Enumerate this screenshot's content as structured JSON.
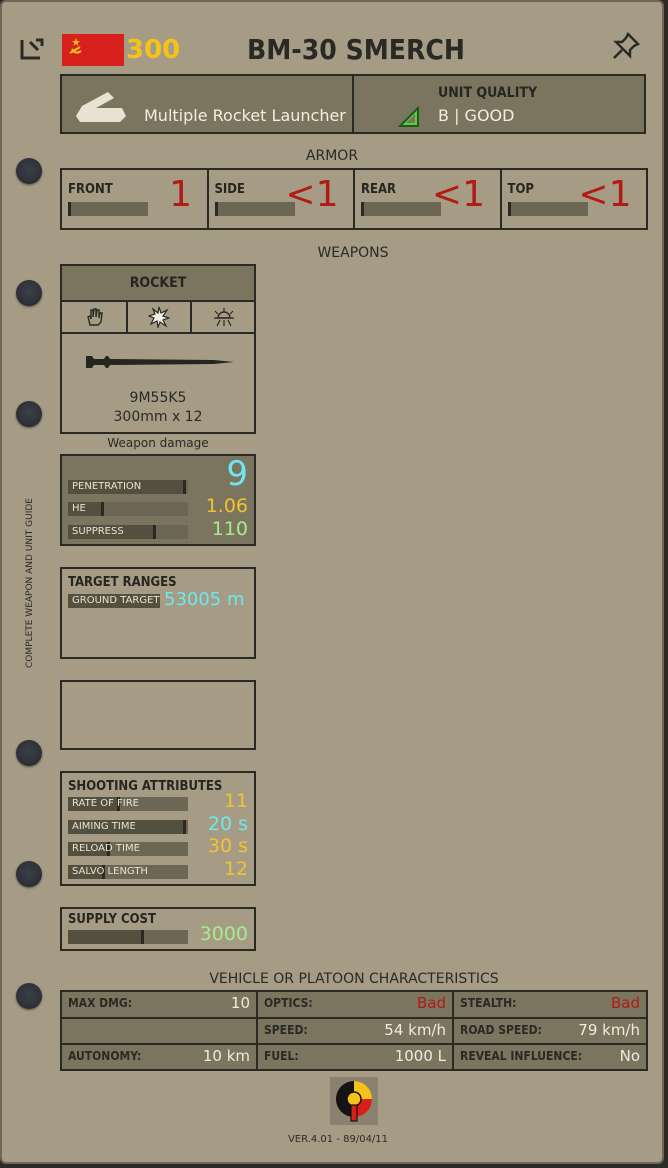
{
  "header": {
    "cost": "300",
    "title": "BM-30 SMERCH",
    "unit_type": "Multiple Rocket Launcher",
    "quality_label": "UNIT QUALITY",
    "quality_value": "B | GOOD"
  },
  "armor": {
    "section_title": "ARMOR",
    "items": [
      {
        "label": "FRONT",
        "value": "1",
        "fill": 0.02
      },
      {
        "label": "SIDE",
        "value": "<1",
        "fill": 0.01
      },
      {
        "label": "REAR",
        "value": "<1",
        "fill": 0.01
      },
      {
        "label": "TOP",
        "value": "<1",
        "fill": 0.01
      }
    ]
  },
  "weapons": {
    "section_title": "WEAPONS",
    "weapon_type": "ROCKET",
    "weapon_name": "9M55K5",
    "caliber": "300mm x 12",
    "damage_caption": "Weapon damage"
  },
  "damage": {
    "penetration_label": "PENETRATION",
    "penetration_value": "9",
    "penetration_fill": 0.98,
    "he_label": "HE",
    "he_value": "1.06",
    "he_fill": 0.3,
    "suppress_label": "SUPPRESS",
    "suppress_value": "110",
    "suppress_fill": 0.73
  },
  "ranges": {
    "title": "TARGET RANGES",
    "ground_label": "GROUND TARGET",
    "ground_value": "53005 m"
  },
  "shooting": {
    "title": "SHOOTING ATTRIBUTES",
    "rows": [
      {
        "label": "RATE OF FIRE",
        "value": "11",
        "fill": 0.43
      },
      {
        "label": "AIMING TIME",
        "value": "20 s",
        "fill": 0.98
      },
      {
        "label": "RELOAD TIME",
        "value": "30 s",
        "fill": 0.35
      },
      {
        "label": "SALVO LENGTH",
        "value": "12",
        "fill": 0.31
      }
    ]
  },
  "supply": {
    "title": "SUPPLY COST",
    "value": "3000",
    "fill": 0.63
  },
  "vehicle": {
    "section_title": "VEHICLE OR PLATOON CHARACTERISTICS",
    "max_dmg_label": "MAX DMG:",
    "max_dmg_value": "10",
    "optics_label": "OPTICS:",
    "optics_value": "Bad",
    "stealth_label": "STEALTH:",
    "stealth_value": "Bad",
    "speed_label": "SPEED:",
    "speed_value": "54 km/h",
    "road_speed_label": "ROAD SPEED:",
    "road_speed_value": "79 km/h",
    "autonomy_label": "AUTONOMY:",
    "autonomy_value": "10 km",
    "fuel_label": "FUEL:",
    "fuel_value": "1000 L",
    "reveal_label": "REVEAL INFLUENCE:",
    "reveal_value": "No"
  },
  "side_text": "COMPLETE WEAPON AND UNIT GUIDE",
  "version": "VER.4.01 - 89/04/11",
  "colors": {
    "paper": "#a69c86",
    "panel": "#7b745f",
    "cost_yellow": "#f5c21c",
    "armor_red": "#b01c14",
    "cyan": "#6ee8ee",
    "yellow": "#f2c230",
    "green": "#a4ec8c",
    "ussr_red": "#d8201c"
  },
  "icons": [
    "collapse-icon",
    "ussr-flag-icon",
    "pin-icon",
    "launcher-icon",
    "quality-triangle-icon",
    "hand-icon",
    "explosion-icon",
    "radar-icon",
    "rocket-icon",
    "emblem-icon"
  ]
}
